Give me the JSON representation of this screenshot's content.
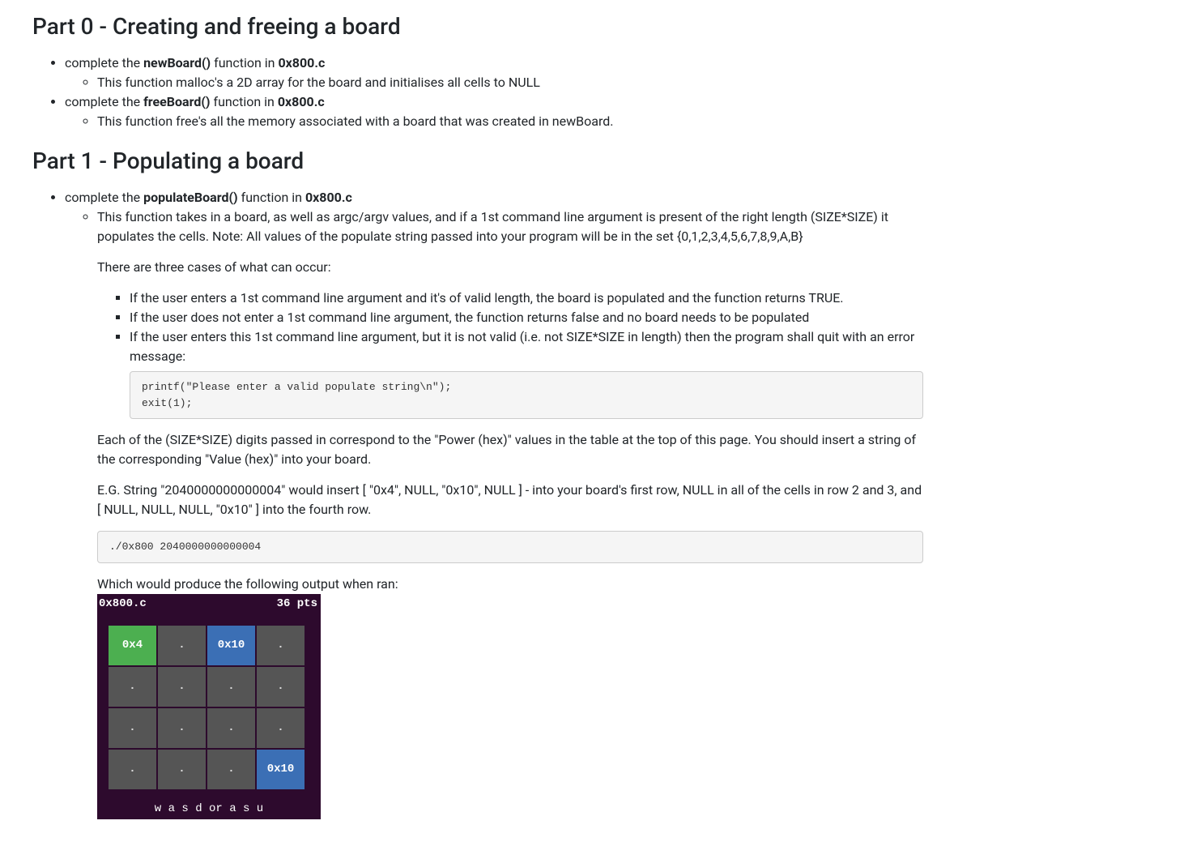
{
  "part0": {
    "heading": "Part 0 - Creating and freeing a board",
    "item1_pre": "complete the ",
    "item1_bold": "newBoard()",
    "item1_mid": " function in ",
    "item1_file": "0x800.c",
    "item1_sub": "This function malloc's a 2D array for the board and initialises all cells to NULL",
    "item2_pre": "complete the ",
    "item2_bold": "freeBoard()",
    "item2_mid": " function in ",
    "item2_file": "0x800.c",
    "item2_sub": "This function free's all the memory associated with a board that was created in newBoard."
  },
  "part1": {
    "heading": "Part 1 - Populating a board",
    "item1_pre": "complete the ",
    "item1_bold": "populateBoard()",
    "item1_mid": " function in ",
    "item1_file": "0x800.c",
    "desc": "This function takes in a board, as well as argc/argv values, and if a 1st command line argument is present of the right length (SIZE*SIZE) it populates the cells. Note: All values of the populate string passed into your program will be in the set {0,1,2,3,4,5,6,7,8,9,A,B}",
    "cases_intro": "There are three cases of what can occur:",
    "case1": "If the user enters a 1st command line argument and it's of valid length, the board is populated and the function returns TRUE.",
    "case2": "If the user does not enter a 1st command line argument, the function returns false and no board needs to be populated",
    "case3": "If the user enters this 1st command line argument, but it is not valid (i.e. not SIZE*SIZE in length) then the program shall quit with an error message:",
    "code_error": "printf(\"Please enter a valid populate string\\n\");\nexit(1);",
    "para2": "Each of the (SIZE*SIZE) digits passed in correspond to the \"Power (hex)\" values in the table at the top of this page. You should insert a string of the corresponding \"Value (hex)\" into your board.",
    "para3": "E.G. String \"2040000000000004\" would insert [ \"0x4\", NULL, \"0x10\", NULL ] - into your board's first row, NULL in all of the cells in row 2 and 3, and [ NULL, NULL, NULL, \"0x10\" ] into the fourth row.",
    "code_run": "./0x800 2040000000000004",
    "output_caption": "Which would produce the following output when ran:"
  },
  "game": {
    "title": "0x800.c",
    "points": "36 pts",
    "cells": [
      {
        "t": "0x4",
        "c": "cell-green"
      },
      {
        "t": ".",
        "c": "cell-empty"
      },
      {
        "t": "0x10",
        "c": "cell-blue"
      },
      {
        "t": ".",
        "c": "cell-empty"
      },
      {
        "t": ".",
        "c": "cell-empty"
      },
      {
        "t": ".",
        "c": "cell-empty"
      },
      {
        "t": ".",
        "c": "cell-empty"
      },
      {
        "t": ".",
        "c": "cell-empty"
      },
      {
        "t": ".",
        "c": "cell-empty"
      },
      {
        "t": ".",
        "c": "cell-empty"
      },
      {
        "t": ".",
        "c": "cell-empty"
      },
      {
        "t": ".",
        "c": "cell-empty"
      },
      {
        "t": ".",
        "c": "cell-empty"
      },
      {
        "t": ".",
        "c": "cell-empty"
      },
      {
        "t": ".",
        "c": "cell-empty"
      },
      {
        "t": "0x10",
        "c": "cell-blue"
      }
    ],
    "footer": "w a s d or a s u"
  }
}
